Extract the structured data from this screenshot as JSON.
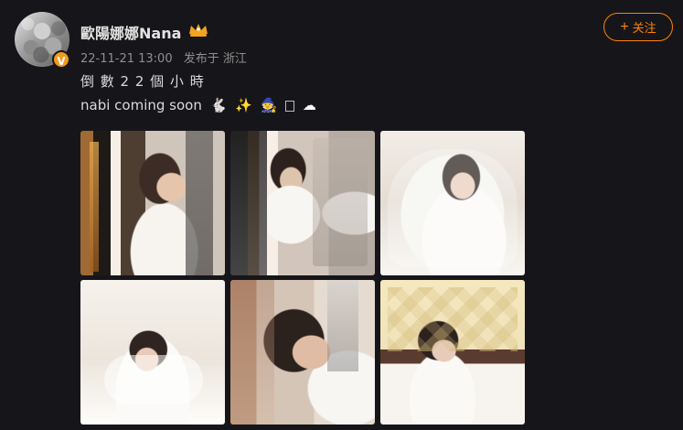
{
  "post": {
    "author_name": "歐陽娜娜Nana",
    "follow_button_label": "关注",
    "timestamp": "22-11-21 13:00",
    "source_label": "发布于 浙江",
    "line_1": "倒 數 2 2 個 小 時",
    "line_2": "nabi coming soon"
  },
  "icons": {
    "verified": "V",
    "crown": "crown-icon",
    "plus": "+",
    "rabbit": "🐇",
    "sparkles": "✨",
    "mage": "🧙",
    "cloud": "☁"
  },
  "colors": {
    "background": "#16161a",
    "text": "#dadada",
    "muted_text": "#8f8f8f",
    "accent": "#ff8200",
    "verified": "#f39a1e"
  }
}
